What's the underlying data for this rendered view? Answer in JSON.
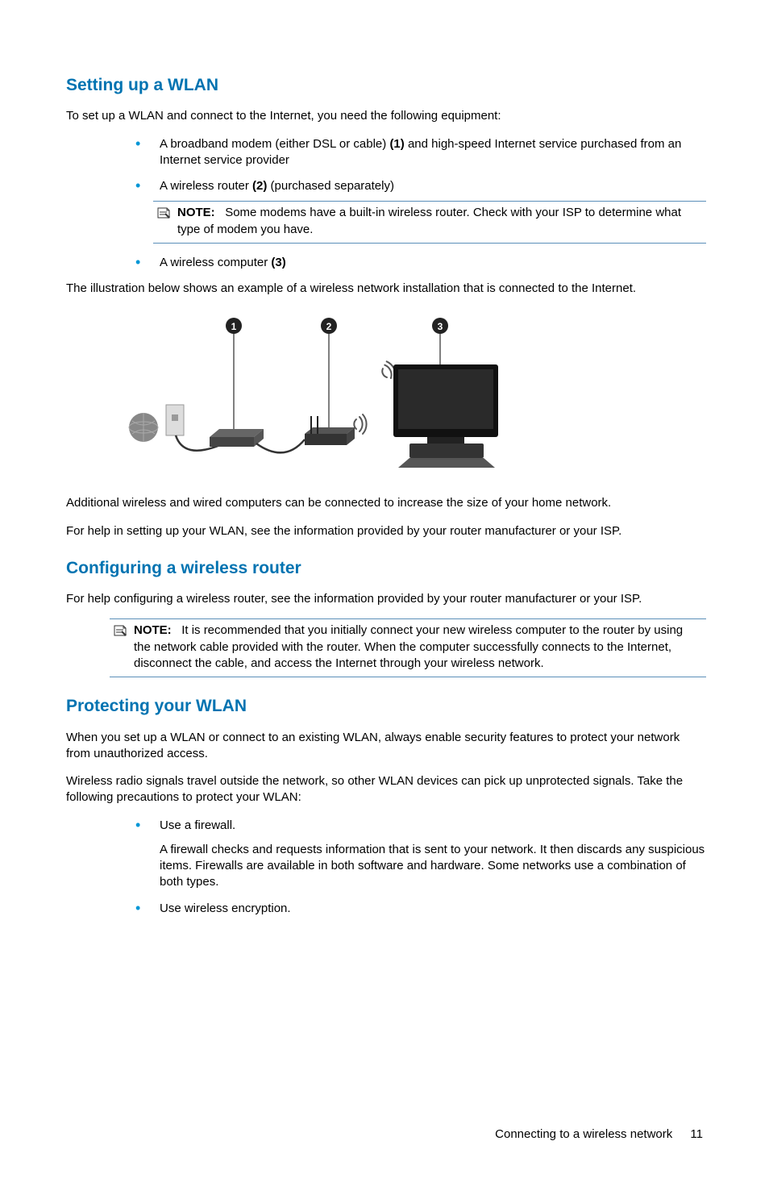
{
  "sections": {
    "s1": {
      "heading": "Setting up a WLAN",
      "intro": "To set up a WLAN and connect to the Internet, you need the following equipment:",
      "item1_a": "A broadband modem (either DSL or cable) ",
      "item1_b": "(1)",
      "item1_c": " and high-speed Internet service purchased from an Internet service provider",
      "item2_a": "A wireless router ",
      "item2_b": "(2)",
      "item2_c": " (purchased separately)",
      "note_label": "NOTE:",
      "note_text": "Some modems have a built-in wireless router. Check with your ISP to determine what type of modem you have.",
      "item3_a": "A wireless computer ",
      "item3_b": "(3)",
      "para_illustration": "The illustration below shows an example of a wireless network installation that is connected to the Internet.",
      "para_additional": "Additional wireless and wired computers can be connected to increase the size of your home network.",
      "para_help": "For help in setting up your WLAN, see the information provided by your router manufacturer or your ISP."
    },
    "s2": {
      "heading": "Configuring a wireless router",
      "para_help": "For help configuring a wireless router, see the information provided by your router manufacturer or your ISP.",
      "note_label": "NOTE:",
      "note_text": "It is recommended that you initially connect your new wireless computer to the router by using the network cable provided with the router. When the computer successfully connects to the Internet, disconnect the cable, and access the Internet through your wireless network."
    },
    "s3": {
      "heading": "Protecting your WLAN",
      "para1": "When you set up a WLAN or connect to an existing WLAN, always enable security features to protect your network from unauthorized access.",
      "para2": "Wireless radio signals travel outside the network, so other WLAN devices can pick up unprotected signals. Take the following precautions to protect your WLAN:",
      "item1": "Use a firewall.",
      "item1_sub": "A firewall checks and requests information that is sent to your network. It then discards any suspicious items. Firewalls are available in both software and hardware. Some networks use a combination of both types.",
      "item2": "Use wireless encryption."
    }
  },
  "footer": {
    "text": "Connecting to a wireless network",
    "page": "11"
  },
  "diagram": {
    "labels": [
      "1",
      "2",
      "3"
    ]
  }
}
